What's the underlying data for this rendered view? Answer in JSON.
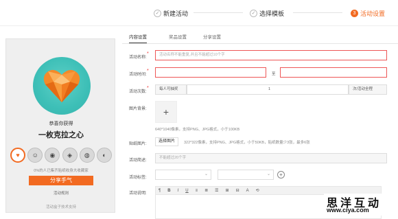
{
  "steps": [
    {
      "label": "新建活动",
      "icon": "check-icon",
      "glyph": "✓"
    },
    {
      "label": "选择模板",
      "icon": "check-icon",
      "glyph": "✓"
    },
    {
      "label": "活动设置",
      "icon": "step-3-icon",
      "glyph": "3"
    }
  ],
  "preview": {
    "congrats": "恭喜你获得",
    "medal_name": "一枚克拉之心",
    "collected_text": "0%的人已集齐贴纸收身大收藏家",
    "share_button": "分享手气",
    "rules_link": "活动规则",
    "support_text": "活动盒子技术支持",
    "badges": [
      "♥",
      "☺",
      "◉",
      "◈",
      "◍",
      "◐"
    ]
  },
  "tabs": [
    "内容设置",
    "奖品设置",
    "分享设置"
  ],
  "form": {
    "name_label": "活动名称:",
    "name_placeholder": "活动名称不能重复,并且不能超过10个字",
    "time_label": "活动时间:",
    "time_to": "至",
    "count_label": "活动次数:",
    "count_prefix": "每人可抽奖",
    "count_value": "1",
    "count_unit": "次/活动全程",
    "bg_label": "图片背景:",
    "bg_plus": "+",
    "bg_hint": "640*1040像素，支持PNG、JPG格式，小于100KB",
    "sticker_label": "贴纸图片:",
    "sticker_button": "选择图片",
    "sticker_hint": "322*322像素，支持PNG、JPG格式，小于50KB，贴纸数量少3张，最多6张",
    "desc_label": "活动简述:",
    "desc_placeholder": "不能超过20个字",
    "tag_label": "活动标签:",
    "tag_add": "+",
    "detail_label": "活动说明:",
    "toolbar": [
      "¶",
      "B",
      "I",
      "U",
      "≡",
      "≣",
      "☰",
      "⊞",
      "⊟",
      "A",
      "⟲"
    ]
  },
  "watermark": {
    "cn": "思洋互动",
    "url": "www.ciya.com"
  }
}
